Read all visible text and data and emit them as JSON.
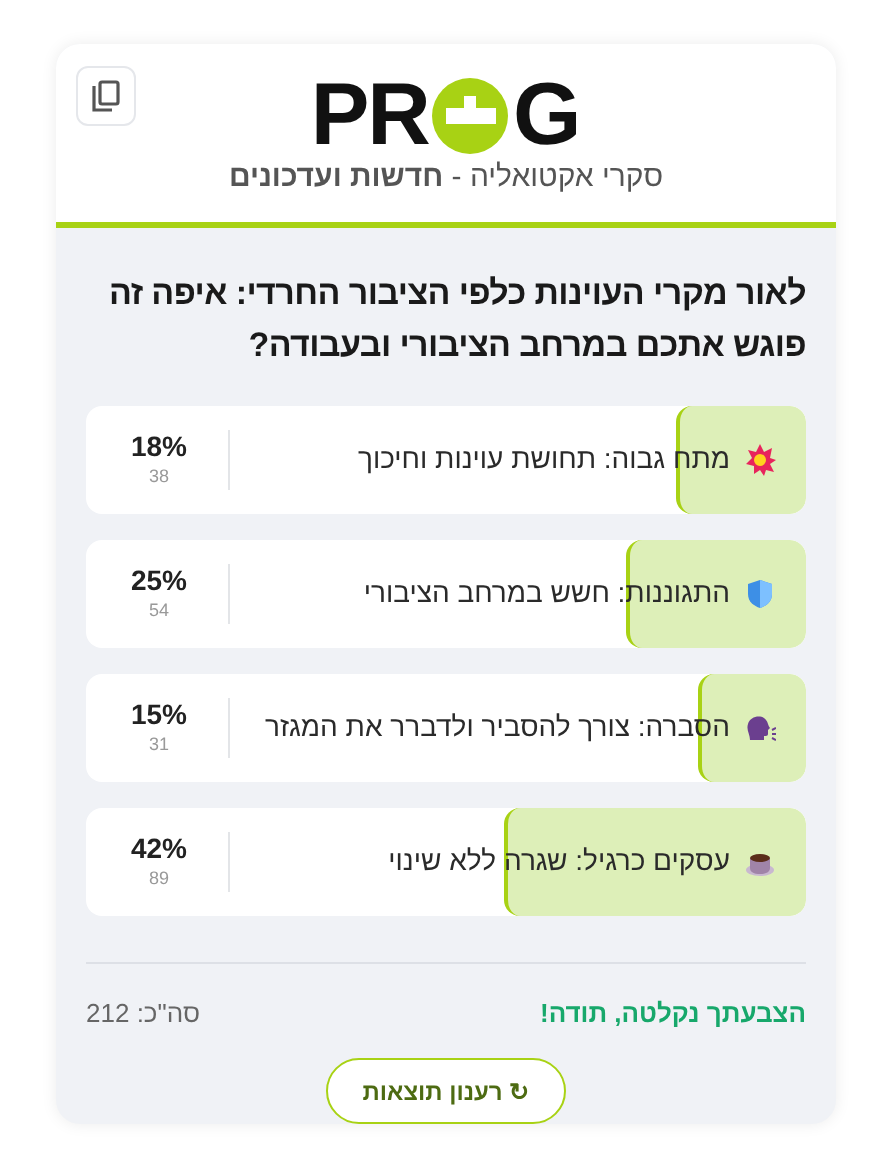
{
  "logo": {
    "left": "PR",
    "right": "G"
  },
  "subtitle": "סקרי אקטואליה - **חדשות ועדכונים**",
  "question": "לאור מקרי העוינות כלפי הציבור החרדי: איפה זה פוגש אתכם במרחב הציבורי ובעבודה?",
  "options": [
    {
      "label": "מתח גבוה: תחושת עוינות וחיכוך",
      "percent": "18%",
      "count": "38",
      "level": 0.18
    },
    {
      "label": "התגוננות: חשש במרחב הציבורי",
      "percent": "25%",
      "count": "54",
      "level": 0.25
    },
    {
      "label": "הסברה: צורך להסביר ולדברר את המגזר",
      "percent": "15%",
      "count": "31",
      "level": 0.15
    },
    {
      "label": "עסקים כרגיל: שגרה ללא שינוי",
      "percent": "42%",
      "count": "89",
      "level": 0.42
    }
  ],
  "thanks": "הצבעתך נקלטה, תודה!",
  "total": "סה\"כ: 212",
  "refresh_button": {
    "icon": "↻",
    "label": "רענון תוצאות"
  }
}
